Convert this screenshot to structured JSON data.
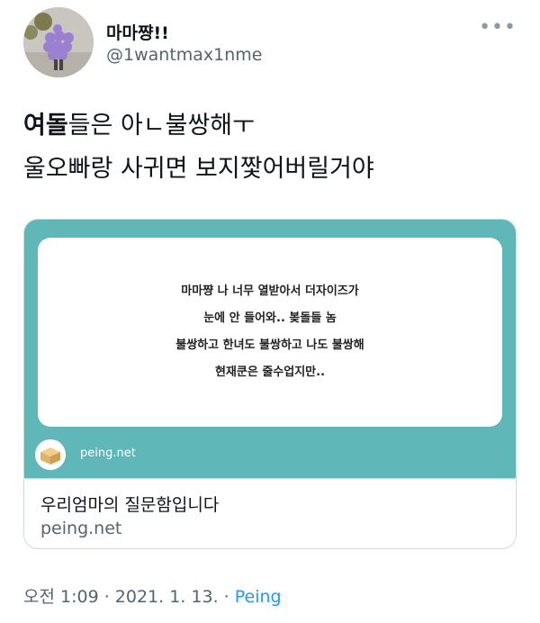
{
  "user": {
    "display_name": "마마쨩!!",
    "handle": "@1wantmax1nme"
  },
  "more_icon": "more-horizontal-icon",
  "tweet": {
    "line1_bold": "여돌",
    "line1_rest": "들은 아ㄴ불쌍해ㅜ",
    "line2": "울오빠랑 사귀면 보지짳어버릴거야"
  },
  "card": {
    "question_lines": [
      "마마쨩 나 너무 열받아서 더자이즈가",
      "눈에 안 들어와.. 봊돌들 놈",
      "불쌍하고 한녀도 불쌍하고 나도 불쌍해",
      "현재쿤은 줄수업지만.."
    ],
    "image_site": "peing.net",
    "title": "우리엄마의 질문함입니다",
    "domain": "peing.net",
    "accent_color": "#5fb8b7"
  },
  "meta": {
    "time": "오전 1:09",
    "sep1": " · ",
    "date": "2021. 1. 13.",
    "sep2": " · ",
    "source": "Peing"
  }
}
